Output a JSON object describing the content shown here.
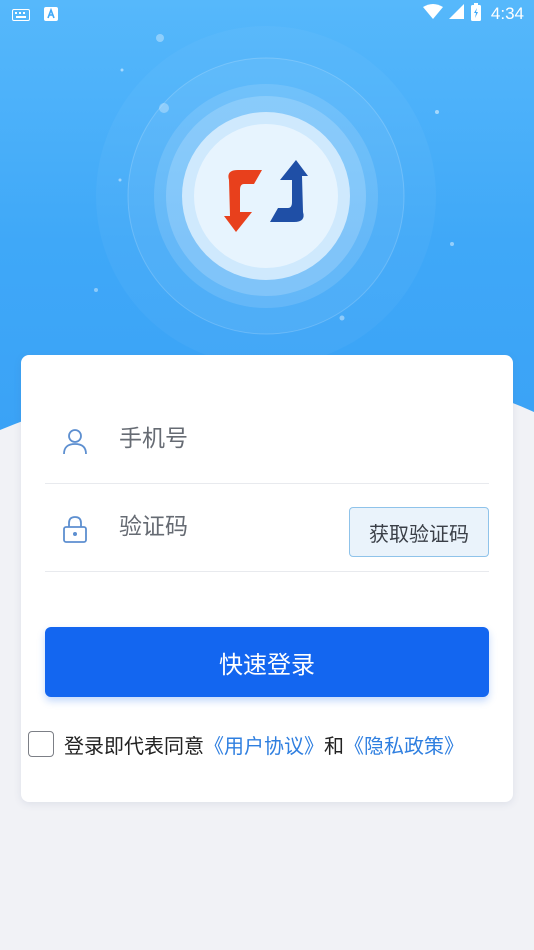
{
  "app": {
    "name": "login-screen"
  },
  "status_bar": {
    "time": "4:34",
    "left_icons": [
      "keyboard-icon",
      "a-badge-icon"
    ],
    "right_icons": [
      "wifi-icon",
      "signal-icon",
      "battery-icon"
    ]
  },
  "logo": {
    "icon": "brand-logo-icon",
    "colors": {
      "red": "#e8401c",
      "blue": "#1f4fa6"
    }
  },
  "form": {
    "phone_placeholder": "手机号",
    "phone_value": "",
    "code_placeholder": "验证码",
    "code_value": "",
    "get_code_label": "获取验证码",
    "submit_label": "快速登录"
  },
  "agreement": {
    "prefix": "登录即代表同意",
    "user_agreement": "《用户协议》",
    "conjunction": "和",
    "privacy_policy": "《隐私政策》",
    "checked": false
  },
  "colors": {
    "primary": "#1366f0",
    "hero": "#3fa8f8",
    "link": "#2f7fe0",
    "background": "#f1f2f6"
  }
}
